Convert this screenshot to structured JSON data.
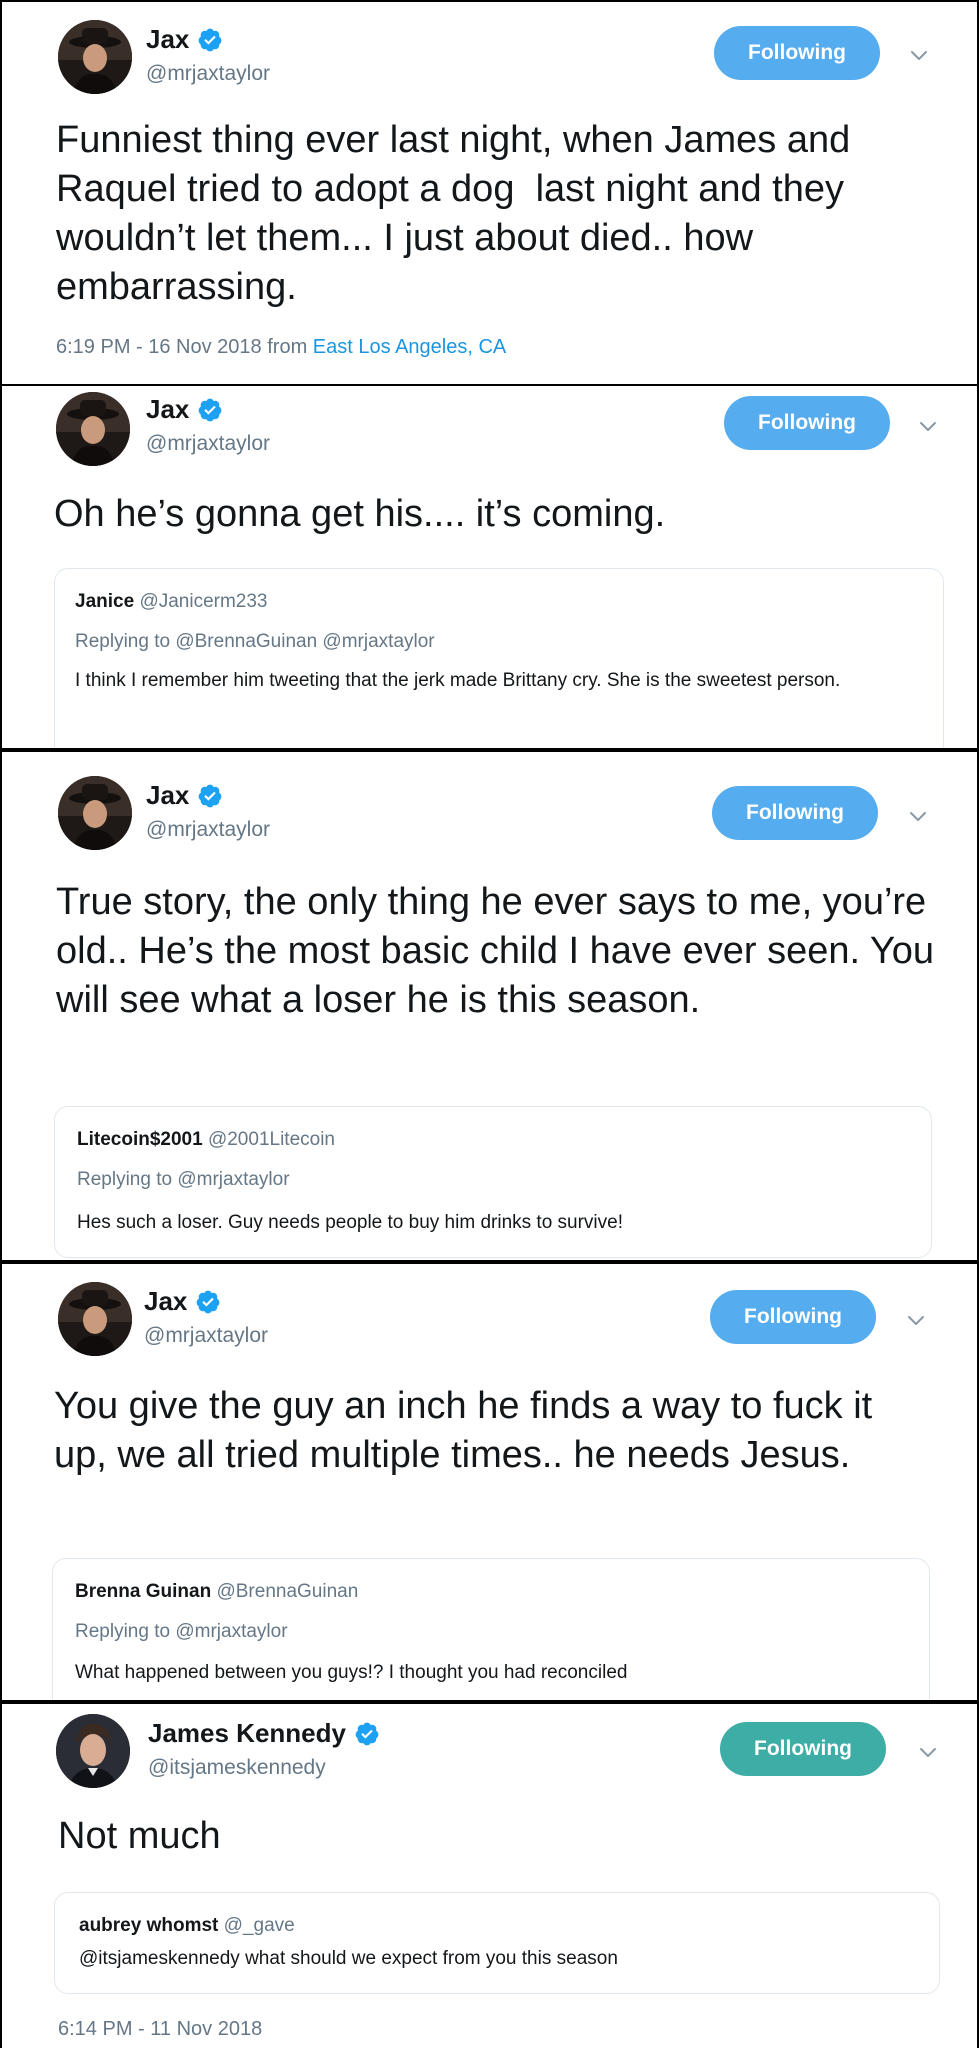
{
  "colors": {
    "follow_blue": "#55acee",
    "follow_teal": "#3dada5",
    "link_blue": "#1b95e0",
    "verified_blue": "#1da1f2"
  },
  "tweets": [
    {
      "name": "Jax",
      "handle": "@mrjaxtaylor",
      "follow_label": "Following",
      "text": "Funniest thing ever last night, when James and Raquel tried to adopt a dog  last night and they wouldn’t let them... I just about died.. how embarrassing.",
      "meta_prefix": "6:19 PM - 16 Nov 2018 from ",
      "meta_location": "East Los Angeles, CA"
    },
    {
      "name": "Jax",
      "handle": "@mrjaxtaylor",
      "follow_label": "Following",
      "text": "Oh he’s gonna get his.... it’s coming.",
      "quote": {
        "name": "Janice",
        "handle": "@Janicerm233",
        "reply": "Replying to @BrennaGuinan @mrjaxtaylor",
        "text": "I think I remember him tweeting that the jerk made Brittany cry. She is the sweetest person."
      }
    },
    {
      "name": "Jax",
      "handle": "@mrjaxtaylor",
      "follow_label": "Following",
      "text": "True story, the only thing he ever says to me, you’re old.. He’s the most basic child I have ever seen. You will see what a loser he is this season.",
      "quote": {
        "name": "Litecoin$2001",
        "handle": "@2001Litecoin",
        "reply": "Replying to @mrjaxtaylor",
        "text": "Hes such a loser. Guy needs people to buy him drinks to survive!"
      }
    },
    {
      "name": "Jax",
      "handle": "@mrjaxtaylor",
      "follow_label": "Following",
      "text": "You give the guy an inch he finds a way to fuck it up, we all tried multiple times.. he needs Jesus.",
      "quote": {
        "name": "Brenna Guinan",
        "handle": "@BrennaGuinan",
        "reply": "Replying to @mrjaxtaylor",
        "text": "What happened between you guys!? I thought you had reconciled"
      }
    },
    {
      "name": "James Kennedy",
      "handle": "@itsjameskennedy",
      "follow_label": "Following",
      "text": "Not much",
      "quote": {
        "name": "aubrey whomst",
        "handle": "@_gave",
        "text": "@itsjameskennedy what should we expect from you this season"
      },
      "meta_prefix": "6:14 PM - 11 Nov 2018"
    }
  ]
}
